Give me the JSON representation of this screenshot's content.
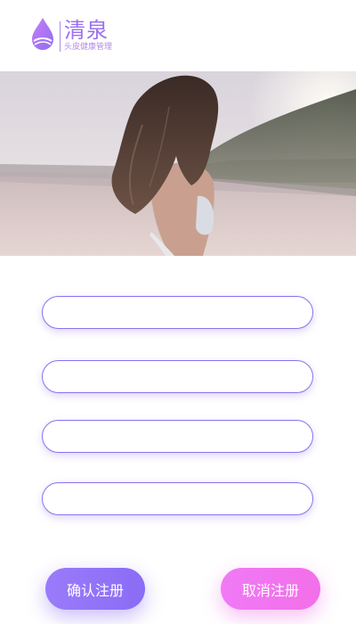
{
  "brand": {
    "name": "清泉",
    "tagline": "头皮健康管理",
    "accent_color": "#9b6ff0"
  },
  "hero": {
    "icon": "hero-photo-woman-on-beach"
  },
  "form": {
    "fields": [
      {
        "value": "",
        "placeholder": ""
      },
      {
        "value": "",
        "placeholder": ""
      },
      {
        "value": "",
        "placeholder": ""
      },
      {
        "value": "",
        "placeholder": ""
      }
    ],
    "field_border_color": "#8d71f0"
  },
  "actions": {
    "confirm_label": "确认注册",
    "cancel_label": "取消注册",
    "confirm_color": "#8a6cf6",
    "cancel_color": "#f26fe8"
  }
}
